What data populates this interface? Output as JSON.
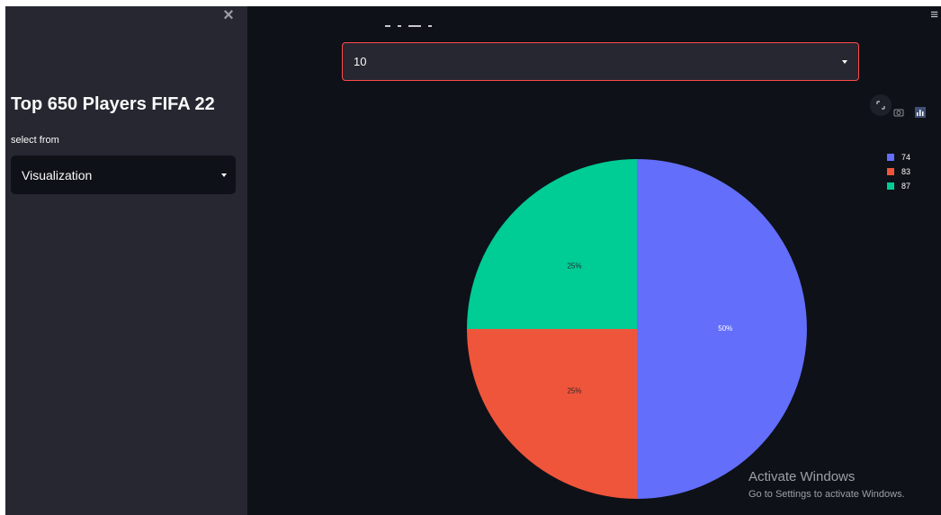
{
  "sidebar": {
    "close_icon": "×",
    "title": "Top 650 Players FIFA 22",
    "select_label": "select from",
    "select_value": "Visualization"
  },
  "main": {
    "menu_icon": "≡",
    "select_value": "10",
    "toolbar": {
      "fullscreen": "fullscreen-icon",
      "camera": "camera-icon",
      "plotly": "plotly-logo-icon"
    }
  },
  "colors": {
    "accent": "#ff4b4b",
    "sidebar_bg": "#262730",
    "main_bg": "#0e1117",
    "series": [
      "#636efa",
      "#ef553b",
      "#00cc96"
    ]
  },
  "chart_data": {
    "type": "pie",
    "slices": [
      {
        "label": "74",
        "percent": 50,
        "color": "#636efa"
      },
      {
        "label": "83",
        "percent": 25,
        "color": "#ef553b"
      },
      {
        "label": "87",
        "percent": 25,
        "color": "#00cc96"
      }
    ],
    "legend_labels": [
      "74",
      "83",
      "87"
    ],
    "slice_texts": [
      "50%",
      "25%",
      "25%"
    ],
    "legend_position": "top-right"
  },
  "watermark": {
    "line1": "Activate Windows",
    "line2": "Go to Settings to activate Windows."
  }
}
